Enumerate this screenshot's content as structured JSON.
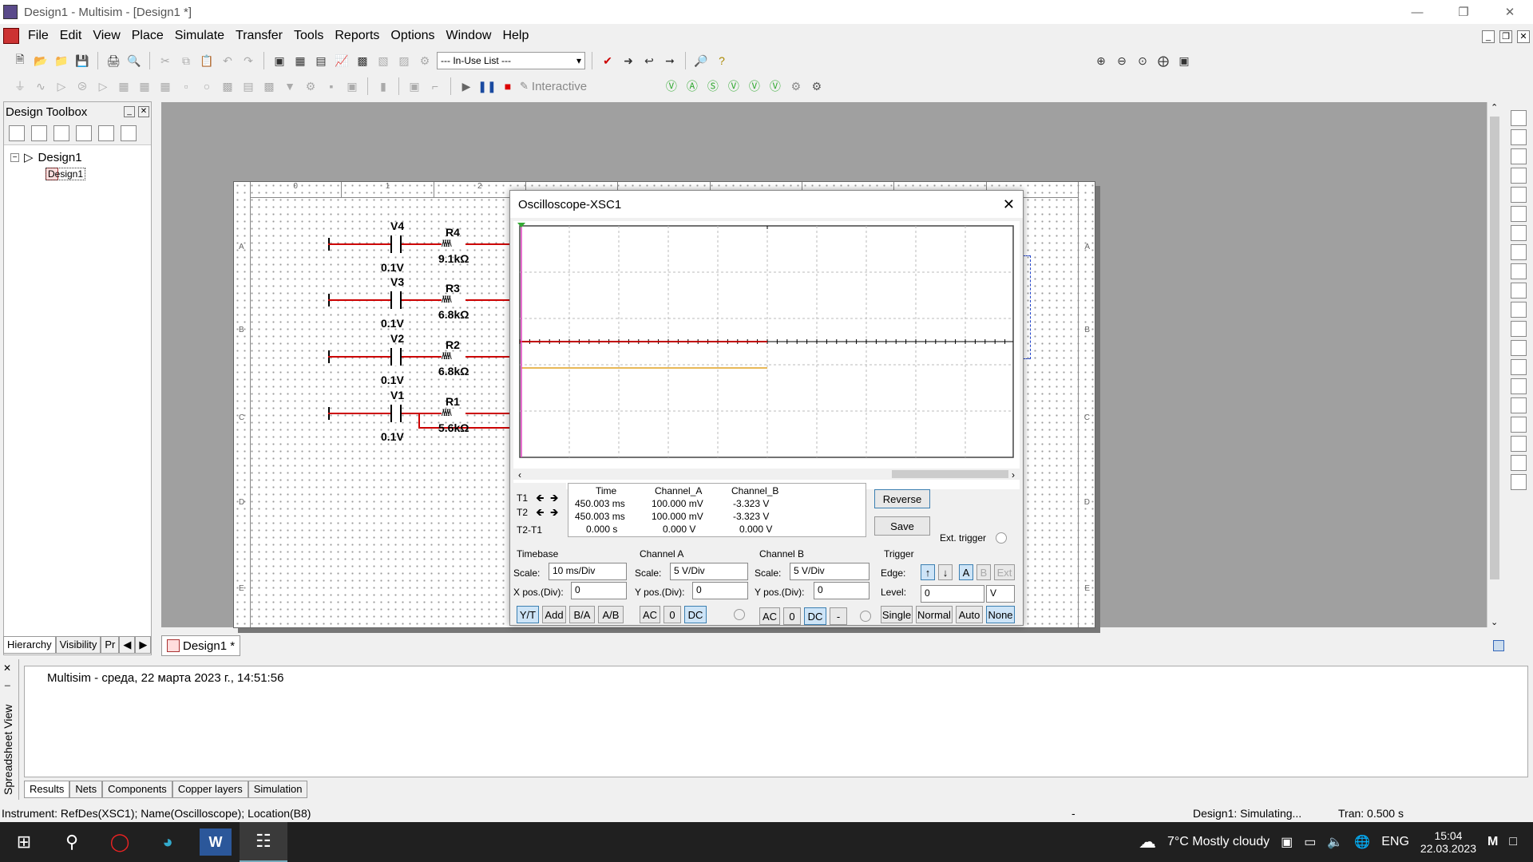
{
  "window": {
    "title": "Design1 - Multisim - [Design1 *]"
  },
  "menu": [
    "File",
    "Edit",
    "View",
    "Place",
    "Simulate",
    "Transfer",
    "Tools",
    "Reports",
    "Options",
    "Window",
    "Help"
  ],
  "toolbar": {
    "inuse_list": "--- In-Use List ---",
    "interactive": "Interactive"
  },
  "toolbox": {
    "title": "Design Toolbox",
    "root": "Design1",
    "child": "Design1",
    "tabs": [
      "Hierarchy",
      "Visibility",
      "Pr"
    ]
  },
  "doc_tab": "Design1 *",
  "schematic": {
    "components": [
      {
        "battery": "V4",
        "voltage": "0.1V",
        "resistor": "R4",
        "resistance": "9.1kΩ"
      },
      {
        "battery": "V3",
        "voltage": "0.1V",
        "resistor": "R3",
        "resistance": "6.8kΩ"
      },
      {
        "battery": "V2",
        "voltage": "0.1V",
        "resistor": "R2",
        "resistance": "6.8kΩ"
      },
      {
        "battery": "V1",
        "voltage": "0.1V",
        "resistor": "R1",
        "resistance": "5.6kΩ"
      }
    ],
    "col_labels": [
      "0",
      "1",
      "2"
    ],
    "row_labels": [
      "A",
      "B",
      "C",
      "D",
      "E"
    ]
  },
  "oscilloscope": {
    "title": "Oscilloscope-XSC1",
    "readout": {
      "headers": [
        "Time",
        "Channel_A",
        "Channel_B"
      ],
      "t1": {
        "label": "T1",
        "time": "450.003 ms",
        "a": "100.000 mV",
        "b": "-3.323 V"
      },
      "t2": {
        "label": "T2",
        "time": "450.003 ms",
        "a": "100.000 mV",
        "b": "-3.323 V"
      },
      "diff": {
        "label": "T2-T1",
        "time": "0.000 s",
        "a": "0.000 V",
        "b": "0.000 V"
      }
    },
    "reverse": "Reverse",
    "save": "Save",
    "ext_trigger": "Ext. trigger",
    "timebase": {
      "title": "Timebase",
      "scale_label": "Scale:",
      "scale": "10 ms/Div",
      "xpos_label": "X pos.(Div):",
      "xpos": "0",
      "modes": [
        "Y/T",
        "Add",
        "B/A",
        "A/B"
      ]
    },
    "channel_a": {
      "title": "Channel A",
      "scale_label": "Scale:",
      "scale": "5  V/Div",
      "ypos_label": "Y pos.(Div):",
      "ypos": "0",
      "coupling": [
        "AC",
        "0",
        "DC"
      ]
    },
    "channel_b": {
      "title": "Channel B",
      "scale_label": "Scale:",
      "scale": "5  V/Div",
      "ypos_label": "Y pos.(Div):",
      "ypos": "0",
      "coupling": [
        "AC",
        "0",
        "DC",
        "-"
      ]
    },
    "trigger": {
      "title": "Trigger",
      "edge_label": "Edge:",
      "edge_buttons": [
        "A",
        "B",
        "Ext"
      ],
      "level_label": "Level:",
      "level": "0",
      "level_unit": "V",
      "modes": [
        "Single",
        "Normal",
        "Auto",
        "None"
      ]
    },
    "colors": {
      "channel_a": "#c00000",
      "channel_b": "#e0a020",
      "cursor_t1": "#e040c0"
    }
  },
  "spreadsheet": {
    "side_label": "Spreadsheet View",
    "log": "Multisim  -  среда, 22 марта 2023 г., 14:51:56",
    "tabs": [
      "Results",
      "Nets",
      "Components",
      "Copper layers",
      "Simulation"
    ]
  },
  "status": {
    "instrument": "Instrument: RefDes(XSC1); Name(Oscilloscope); Location(B8)",
    "dash": "-",
    "sim": "Design1: Simulating...",
    "tran": "Tran: 0.500 s"
  },
  "taskbar": {
    "weather": "7°C  Mostly cloudy",
    "lang": "ENG",
    "time": "15:04",
    "date": "22.03.2023"
  }
}
